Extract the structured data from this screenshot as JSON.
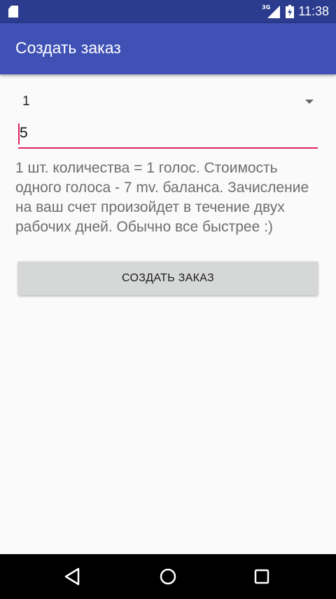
{
  "status_bar": {
    "network_type": "3G",
    "time": "11:38"
  },
  "app_bar": {
    "title": "Создать заказ"
  },
  "form": {
    "spinner_value": "1",
    "quantity_value": "5",
    "info_text": "1 шт. количества = 1 голос. Стоимость одного голоса - 7 mv. баланса. Зачисление на ваш счет произойдет в течение двух рабочих дней. Обычно все быстрее :)",
    "create_button_label": "СОЗДАТЬ ЗАКАЗ"
  },
  "colors": {
    "status_bar": "#2b3b8e",
    "app_bar": "#3f51b5",
    "accent": "#e0245e",
    "background": "#fafafa",
    "button": "#d6d7d7"
  },
  "icons": {
    "status": [
      "sd-card-icon",
      "signal-icon",
      "battery-charging-icon"
    ],
    "navigation": [
      "back-icon",
      "home-icon",
      "recents-icon"
    ]
  }
}
